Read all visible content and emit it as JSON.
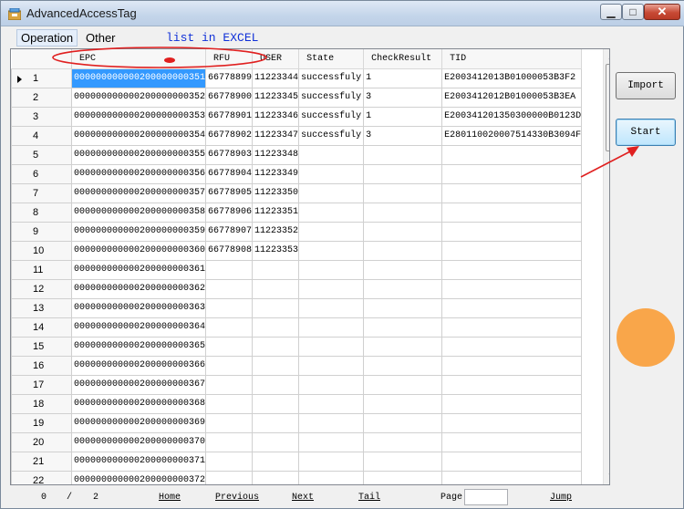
{
  "window": {
    "title": "AdvancedAccessTag"
  },
  "menu": {
    "operation": "Operation",
    "other": "Other"
  },
  "annotation": {
    "text": "list in EXCEL",
    "color": "#1030d8",
    "marker_color": "#e02020"
  },
  "grid": {
    "columns": [
      "EPC",
      "RFU",
      "USER",
      "State",
      "CheckResult",
      "TID"
    ],
    "rows": [
      {
        "n": "1",
        "epc": "000000000000200000000351",
        "rfu": "66778899",
        "user": "11223344",
        "state": "successfuly",
        "check": "1",
        "tid": "E2003412013B01000053B3F2"
      },
      {
        "n": "2",
        "epc": "000000000000200000000352",
        "rfu": "66778900",
        "user": "11223345",
        "state": "successfuly",
        "check": "3",
        "tid": "E2003412012B01000053B3EA"
      },
      {
        "n": "3",
        "epc": "000000000000200000000353",
        "rfu": "66778901",
        "user": "11223346",
        "state": "successfuly",
        "check": "1",
        "tid": "E200341201350300000B0123D"
      },
      {
        "n": "4",
        "epc": "000000000000200000000354",
        "rfu": "66778902",
        "user": "11223347",
        "state": "successfuly",
        "check": "3",
        "tid": "E280110020007514330B3094F"
      },
      {
        "n": "5",
        "epc": "000000000000200000000355",
        "rfu": "66778903",
        "user": "11223348",
        "state": "",
        "check": "",
        "tid": ""
      },
      {
        "n": "6",
        "epc": "000000000000200000000356",
        "rfu": "66778904",
        "user": "11223349",
        "state": "",
        "check": "",
        "tid": ""
      },
      {
        "n": "7",
        "epc": "000000000000200000000357",
        "rfu": "66778905",
        "user": "11223350",
        "state": "",
        "check": "",
        "tid": ""
      },
      {
        "n": "8",
        "epc": "000000000000200000000358",
        "rfu": "66778906",
        "user": "11223351",
        "state": "",
        "check": "",
        "tid": ""
      },
      {
        "n": "9",
        "epc": "000000000000200000000359",
        "rfu": "66778907",
        "user": "11223352",
        "state": "",
        "check": "",
        "tid": ""
      },
      {
        "n": "10",
        "epc": "000000000000200000000360",
        "rfu": "66778908",
        "user": "11223353",
        "state": "",
        "check": "",
        "tid": ""
      },
      {
        "n": "11",
        "epc": "000000000000200000000361",
        "rfu": "",
        "user": "",
        "state": "",
        "check": "",
        "tid": ""
      },
      {
        "n": "12",
        "epc": "000000000000200000000362",
        "rfu": "",
        "user": "",
        "state": "",
        "check": "",
        "tid": ""
      },
      {
        "n": "13",
        "epc": "000000000000200000000363",
        "rfu": "",
        "user": "",
        "state": "",
        "check": "",
        "tid": ""
      },
      {
        "n": "14",
        "epc": "000000000000200000000364",
        "rfu": "",
        "user": "",
        "state": "",
        "check": "",
        "tid": ""
      },
      {
        "n": "15",
        "epc": "000000000000200000000365",
        "rfu": "",
        "user": "",
        "state": "",
        "check": "",
        "tid": ""
      },
      {
        "n": "16",
        "epc": "000000000000200000000366",
        "rfu": "",
        "user": "",
        "state": "",
        "check": "",
        "tid": ""
      },
      {
        "n": "17",
        "epc": "000000000000200000000367",
        "rfu": "",
        "user": "",
        "state": "",
        "check": "",
        "tid": ""
      },
      {
        "n": "18",
        "epc": "000000000000200000000368",
        "rfu": "",
        "user": "",
        "state": "",
        "check": "",
        "tid": ""
      },
      {
        "n": "19",
        "epc": "000000000000200000000369",
        "rfu": "",
        "user": "",
        "state": "",
        "check": "",
        "tid": ""
      },
      {
        "n": "20",
        "epc": "000000000000200000000370",
        "rfu": "",
        "user": "",
        "state": "",
        "check": "",
        "tid": ""
      },
      {
        "n": "21",
        "epc": "000000000000200000000371",
        "rfu": "",
        "user": "",
        "state": "",
        "check": "",
        "tid": ""
      },
      {
        "n": "22",
        "epc": "000000000000200000000372",
        "rfu": "",
        "user": "",
        "state": "",
        "check": "",
        "tid": ""
      }
    ]
  },
  "buttons": {
    "import": "Import",
    "start": "Start"
  },
  "pager": {
    "current": "0",
    "separator": "/",
    "total": "2",
    "home": "Home",
    "previous": "Previous",
    "next": "Next",
    "tail": "Tail",
    "page_label": "Page",
    "page_value": "",
    "jump": "Jump"
  },
  "colors": {
    "selection": "#3399ff",
    "orange_dot": "#f9a64a",
    "arrow": "#e02020"
  }
}
